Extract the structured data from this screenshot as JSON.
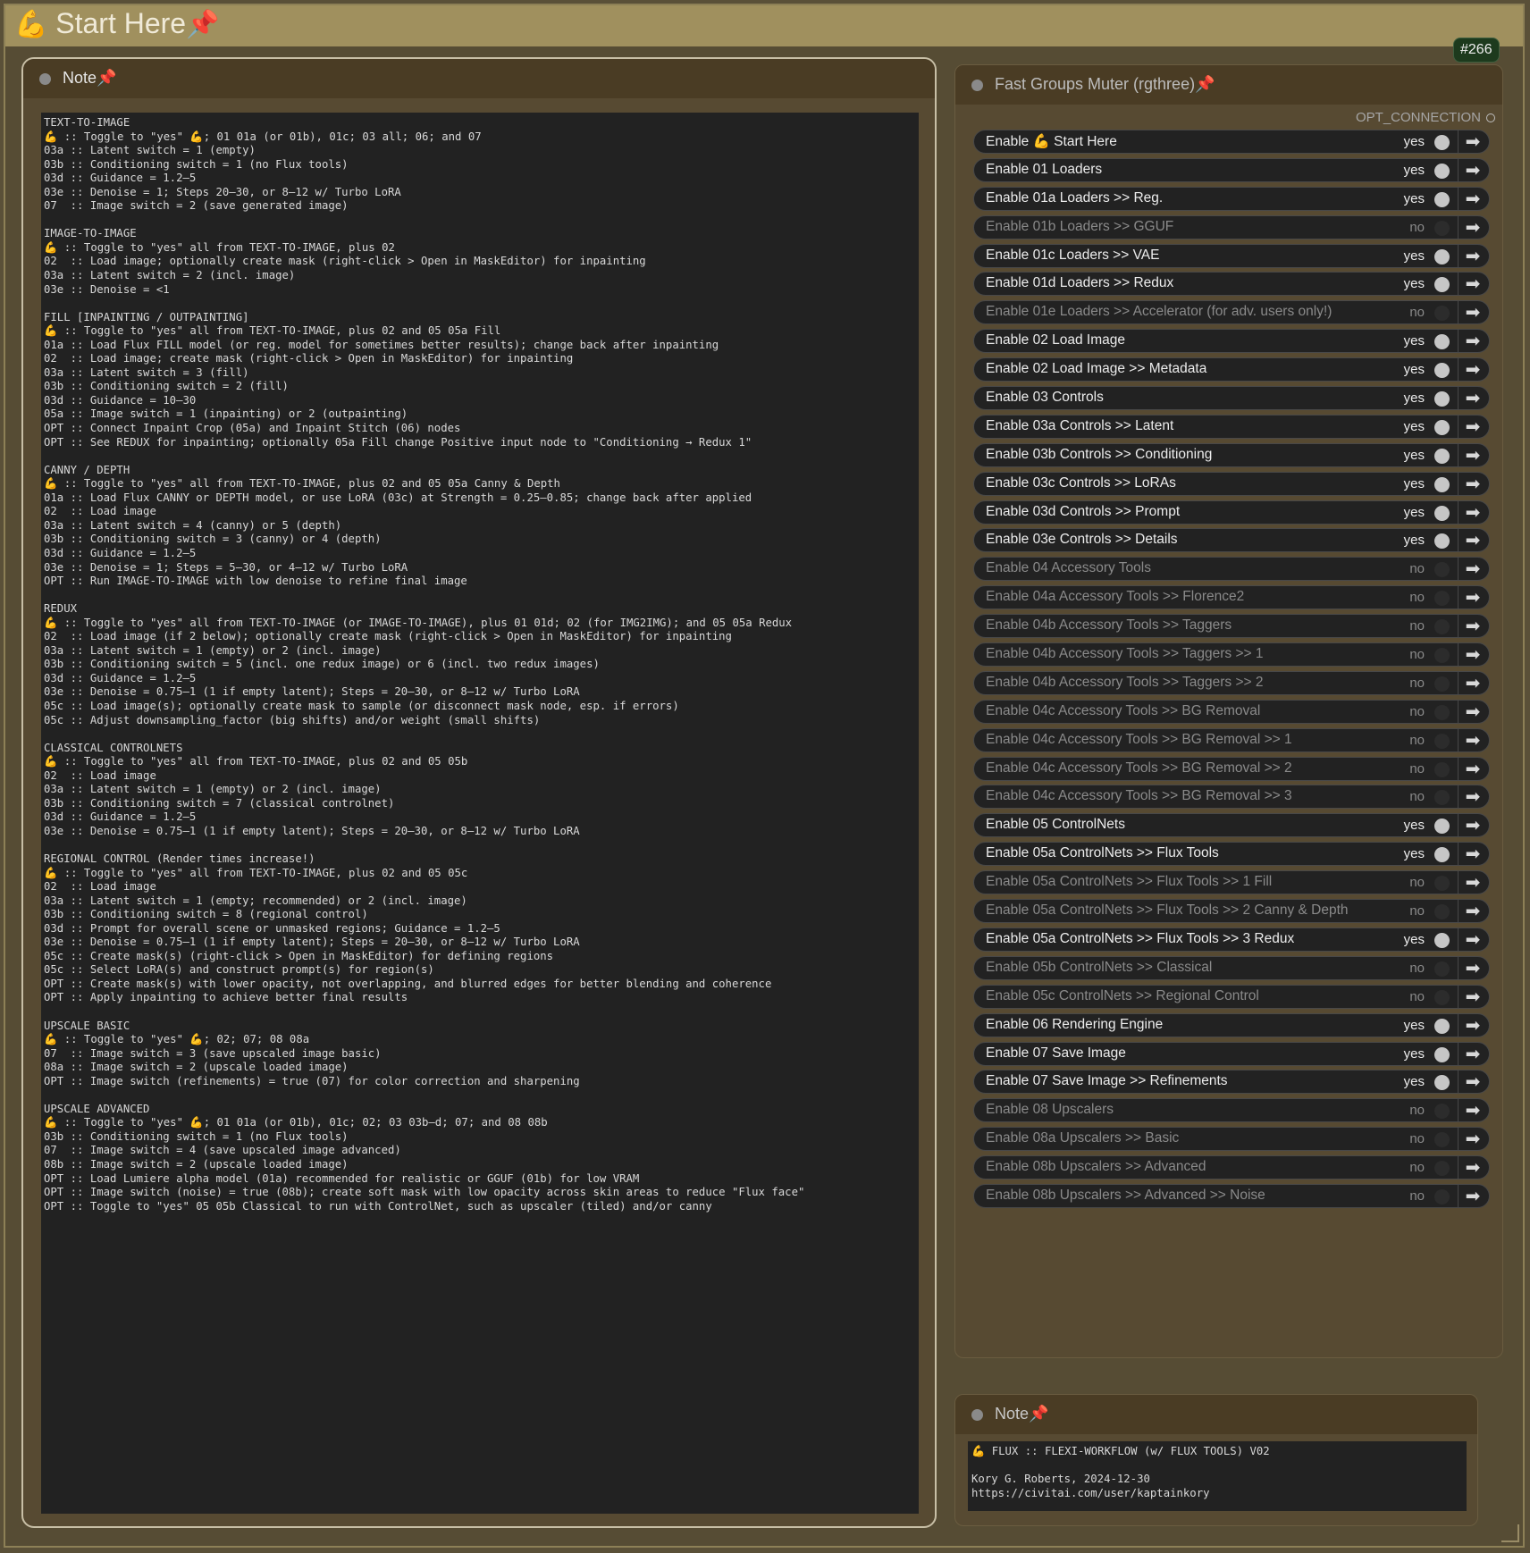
{
  "group": {
    "title_emoji": "💪",
    "title": "Start Here",
    "pin": "📌",
    "badge": "#266",
    "color": "#a0905e"
  },
  "left_note": {
    "title": "Note",
    "pin": "📌",
    "lines": [
      "TEXT-TO-IMAGE",
      "💪 :: Toggle to \"yes\" 💪; 01 01a (or 01b), 01c; 03 all; 06; and 07",
      "03a :: Latent switch = 1 (empty)",
      "03b :: Conditioning switch = 1 (no Flux tools)",
      "03d :: Guidance = 1.2–5",
      "03e :: Denoise = 1; Steps 20–30, or 8–12 w/ Turbo LoRA",
      "07  :: Image switch = 2 (save generated image)",
      "",
      "IMAGE-TO-IMAGE",
      "💪 :: Toggle to \"yes\" all from TEXT-TO-IMAGE, plus 02",
      "02  :: Load image; optionally create mask (right-click > Open in MaskEditor) for inpainting",
      "03a :: Latent switch = 2 (incl. image)",
      "03e :: Denoise = <1",
      "",
      "FILL [INPAINTING / OUTPAINTING]",
      "💪 :: Toggle to \"yes\" all from TEXT-TO-IMAGE, plus 02 and 05 05a Fill",
      "01a :: Load Flux FILL model (or reg. model for sometimes better results); change back after inpainting",
      "02  :: Load image; create mask (right-click > Open in MaskEditor) for inpainting",
      "03a :: Latent switch = 3 (fill)",
      "03b :: Conditioning switch = 2 (fill)",
      "03d :: Guidance = 10–30",
      "05a :: Image switch = 1 (inpainting) or 2 (outpainting)",
      "OPT :: Connect Inpaint Crop (05a) and Inpaint Stitch (06) nodes",
      "OPT :: See REDUX for inpainting; optionally 05a Fill change Positive input node to \"Conditioning → Redux 1\"",
      "",
      "CANNY / DEPTH",
      "💪 :: Toggle to \"yes\" all from TEXT-TO-IMAGE, plus 02 and 05 05a Canny & Depth",
      "01a :: Load Flux CANNY or DEPTH model, or use LoRA (03c) at Strength = 0.25–0.85; change back after applied",
      "02  :: Load image",
      "03a :: Latent switch = 4 (canny) or 5 (depth)",
      "03b :: Conditioning switch = 3 (canny) or 4 (depth)",
      "03d :: Guidance = 1.2–5",
      "03e :: Denoise = 1; Steps = 5–30, or 4–12 w/ Turbo LoRA",
      "OPT :: Run IMAGE-TO-IMAGE with low denoise to refine final image",
      "",
      "REDUX",
      "💪 :: Toggle to \"yes\" all from TEXT-TO-IMAGE (or IMAGE-TO-IMAGE), plus 01 01d; 02 (for IMG2IMG); and 05 05a Redux",
      "02  :: Load image (if 2 below); optionally create mask (right-click > Open in MaskEditor) for inpainting",
      "03a :: Latent switch = 1 (empty) or 2 (incl. image)",
      "03b :: Conditioning switch = 5 (incl. one redux image) or 6 (incl. two redux images)",
      "03d :: Guidance = 1.2–5",
      "03e :: Denoise = 0.75–1 (1 if empty latent); Steps = 20–30, or 8–12 w/ Turbo LoRA",
      "05c :: Load image(s); optionally create mask to sample (or disconnect mask node, esp. if errors)",
      "05c :: Adjust downsampling_factor (big shifts) and/or weight (small shifts)",
      "",
      "CLASSICAL CONTROLNETS",
      "💪 :: Toggle to \"yes\" all from TEXT-TO-IMAGE, plus 02 and 05 05b",
      "02  :: Load image",
      "03a :: Latent switch = 1 (empty) or 2 (incl. image)",
      "03b :: Conditioning switch = 7 (classical controlnet)",
      "03d :: Guidance = 1.2–5",
      "03e :: Denoise = 0.75–1 (1 if empty latent); Steps = 20–30, or 8–12 w/ Turbo LoRA",
      "",
      "REGIONAL CONTROL (Render times increase!)",
      "💪 :: Toggle to \"yes\" all from TEXT-TO-IMAGE, plus 02 and 05 05c",
      "02  :: Load image",
      "03a :: Latent switch = 1 (empty; recommended) or 2 (incl. image)",
      "03b :: Conditioning switch = 8 (regional control)",
      "03d :: Prompt for overall scene or unmasked regions; Guidance = 1.2–5",
      "03e :: Denoise = 0.75–1 (1 if empty latent); Steps = 20–30, or 8–12 w/ Turbo LoRA",
      "05c :: Create mask(s) (right-click > Open in MaskEditor) for defining regions",
      "05c :: Select LoRA(s) and construct prompt(s) for region(s)",
      "OPT :: Create mask(s) with lower opacity, not overlapping, and blurred edges for better blending and coherence",
      "OPT :: Apply inpainting to achieve better final results",
      "",
      "UPSCALE BASIC",
      "💪 :: Toggle to \"yes\" 💪; 02; 07; 08 08a",
      "07  :: Image switch = 3 (save upscaled image basic)",
      "08a :: Image switch = 2 (upscale loaded image)",
      "OPT :: Image switch (refinements) = true (07) for color correction and sharpening",
      "",
      "UPSCALE ADVANCED",
      "💪 :: Toggle to \"yes\" 💪; 01 01a (or 01b), 01c; 02; 03 03b–d; 07; and 08 08b",
      "03b :: Conditioning switch = 1 (no Flux tools)",
      "07  :: Image switch = 4 (save upscaled image advanced)",
      "08b :: Image switch = 2 (upscale loaded image)",
      "OPT :: Load Lumiere alpha model (01a) recommended for realistic or GGUF (01b) for low VRAM",
      "OPT :: Image switch (noise) = true (08b); create soft mask with low opacity across skin areas to reduce \"Flux face\"",
      "OPT :: Toggle to \"yes\" 05 05b Classical to run with ControlNet, such as upscaler (tiled) and/or canny"
    ]
  },
  "muter": {
    "title": "Fast Groups Muter (rgthree)",
    "pin": "📌",
    "output_label": "OPT_CONNECTION",
    "arrow_icon": "arrow-right-icon",
    "rows": [
      {
        "label": "Enable 💪 Start Here",
        "state": "yes"
      },
      {
        "label": "Enable 01 Loaders",
        "state": "yes"
      },
      {
        "label": "Enable 01a Loaders >> Reg.",
        "state": "yes"
      },
      {
        "label": "Enable 01b Loaders >> GGUF",
        "state": "no"
      },
      {
        "label": "Enable 01c Loaders >> VAE",
        "state": "yes"
      },
      {
        "label": "Enable 01d Loaders >> Redux",
        "state": "yes"
      },
      {
        "label": "Enable 01e Loaders >> Accelerator (for adv. users only!)",
        "state": "no"
      },
      {
        "label": "Enable 02 Load Image",
        "state": "yes"
      },
      {
        "label": "Enable 02 Load Image >> Metadata",
        "state": "yes"
      },
      {
        "label": "Enable 03 Controls",
        "state": "yes"
      },
      {
        "label": "Enable 03a Controls >> Latent",
        "state": "yes"
      },
      {
        "label": "Enable 03b Controls >> Conditioning",
        "state": "yes"
      },
      {
        "label": "Enable 03c Controls >> LoRAs",
        "state": "yes"
      },
      {
        "label": "Enable 03d Controls >> Prompt",
        "state": "yes"
      },
      {
        "label": "Enable 03e Controls >> Details",
        "state": "yes"
      },
      {
        "label": "Enable 04 Accessory Tools",
        "state": "no"
      },
      {
        "label": "Enable 04a Accessory Tools >> Florence2",
        "state": "no"
      },
      {
        "label": "Enable 04b Accessory Tools >> Taggers",
        "state": "no"
      },
      {
        "label": "Enable 04b Accessory Tools >> Taggers >> 1",
        "state": "no"
      },
      {
        "label": "Enable 04b Accessory Tools >> Taggers >> 2",
        "state": "no"
      },
      {
        "label": "Enable 04c Accessory Tools >> BG Removal",
        "state": "no"
      },
      {
        "label": "Enable 04c Accessory Tools >> BG Removal >> 1",
        "state": "no"
      },
      {
        "label": "Enable 04c Accessory Tools >> BG Removal >> 2",
        "state": "no"
      },
      {
        "label": "Enable 04c Accessory Tools >> BG Removal >> 3",
        "state": "no"
      },
      {
        "label": "Enable 05 ControlNets",
        "state": "yes"
      },
      {
        "label": "Enable 05a ControlNets >> Flux Tools",
        "state": "yes"
      },
      {
        "label": "Enable 05a ControlNets >> Flux Tools >> 1 Fill",
        "state": "no"
      },
      {
        "label": "Enable 05a ControlNets >> Flux Tools >> 2 Canny & Depth",
        "state": "no"
      },
      {
        "label": "Enable 05a ControlNets >> Flux Tools >> 3 Redux",
        "state": "yes"
      },
      {
        "label": "Enable 05b ControlNets >> Classical",
        "state": "no"
      },
      {
        "label": "Enable 05c ControlNets >> Regional Control",
        "state": "no"
      },
      {
        "label": "Enable 06 Rendering Engine",
        "state": "yes"
      },
      {
        "label": "Enable 07 Save Image",
        "state": "yes"
      },
      {
        "label": "Enable 07 Save Image >> Refinements",
        "state": "yes"
      },
      {
        "label": "Enable 08 Upscalers",
        "state": "no"
      },
      {
        "label": "Enable 08a Upscalers >> Basic",
        "state": "no"
      },
      {
        "label": "Enable 08b Upscalers >> Advanced",
        "state": "no"
      },
      {
        "label": "Enable 08b Upscalers >> Advanced >> Noise",
        "state": "no"
      }
    ]
  },
  "bottom_note": {
    "title": "Note",
    "pin": "📌",
    "lines": [
      "💪 FLUX :: FLEXI-WORKFLOW (w/ FLUX TOOLS) V02",
      "",
      "Kory G. Roberts, 2024-12-30",
      "https://civitai.com/user/kaptainkory"
    ]
  }
}
